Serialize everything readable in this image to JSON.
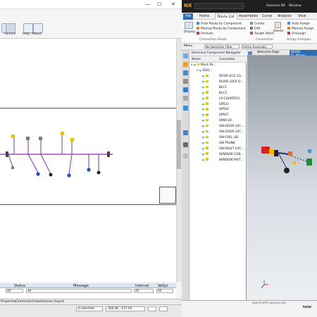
{
  "left_app": {
    "ribbon": {
      "launch_label": "Launch",
      "help_label": "Help",
      "about_label": "About"
    },
    "messages": {
      "columns": [
        "",
        "Status",
        "Message",
        "Internal",
        "VeSys"
      ],
      "filter_values": [
        "All",
        "All",
        "All",
        "All",
        "All"
      ]
    },
    "bottom_tabs": [
      "Properties",
      "Comments",
      "Index",
      "Harness Import"
    ],
    "status": {
      "selection": "0 selected",
      "coordinates": "326.46, -137.03"
    }
  },
  "nx": {
    "title": "NX",
    "app_label": "Siemens NX",
    "app_menu": "Window",
    "tabs": [
      "File",
      "Home",
      "Route List",
      "Assemblies",
      "Curve",
      "Analysis",
      "View"
    ],
    "ribbon": {
      "display_label": "Display",
      "auto_route_label": "Auto Route by Component",
      "manual_route_label": "Manual Route by Component",
      "unroute_label": "Unroute",
      "create_label": "Create",
      "edit_label": "Edit",
      "assign_stock_label": "Assign Stock",
      "delete_label": "Delete",
      "auto_assign_label": "Auto Assign",
      "manual_assign_label": "Manual Assign",
      "unassign_label": "Unassign",
      "group_connection_route": "Connection Route",
      "group_connection": "Connection",
      "group_assign": "Assign Compon..."
    },
    "toolbar": {
      "menu_label": "Menu",
      "filter_value": "No Selection Filter",
      "scope_value": "Entire Assembly"
    },
    "navigator": {
      "title": "Electrical Component Navigator",
      "columns": [
        "Name",
        "Connector"
      ],
      "tree_root": "Mock Pa...",
      "tree_child": "DOO...",
      "rows": [
        "DOOR ECU CO...",
        "DOOR LOCK D...",
        "BLC1",
        "BLC2",
        "LP-COURTESY...",
        "SPR23",
        "SPR24",
        "SPR27",
        "SPKR-LR",
        "SW-DOOR LOC...",
        "SW-DOOR LOC...",
        "SW-FUEL LID",
        "SW-TRUNK",
        "SW-VALET LOC...",
        "WINDOW CON...",
        "WINDOW MOT..."
      ]
    },
    "graphics_tabs": [
      "Welcome Page",
      "DOOR-FL_Wrapp..."
    ],
    "status": {
      "route_text": "Last ROUTE Connect Left",
      "badge": "total"
    }
  }
}
